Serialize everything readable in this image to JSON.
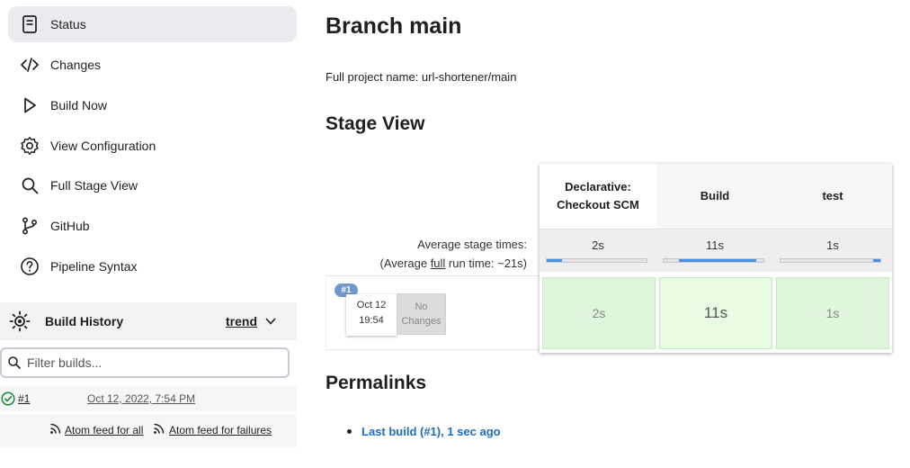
{
  "sidebar": {
    "items": [
      {
        "label": "Status",
        "icon": "document-icon",
        "active": true
      },
      {
        "label": "Changes",
        "icon": "code-icon"
      },
      {
        "label": "Build Now",
        "icon": "play-icon"
      },
      {
        "label": "View Configuration",
        "icon": "gear-icon"
      },
      {
        "label": "Full Stage View",
        "icon": "search-icon"
      },
      {
        "label": "GitHub",
        "icon": "branch-icon"
      },
      {
        "label": "Pipeline Syntax",
        "icon": "help-icon"
      }
    ]
  },
  "build_history": {
    "title": "Build History",
    "trend_label": "trend",
    "filter_placeholder": "Filter builds...",
    "builds": [
      {
        "number": "#1",
        "date": "Oct 12, 2022, 7:54 PM",
        "status": "success"
      }
    ],
    "feed_all": "Atom feed for all",
    "feed_failures": "Atom feed for failures"
  },
  "main": {
    "title": "Branch main",
    "full_name": "Full project name: url-shortener/main",
    "stage_view_title": "Stage View",
    "permalinks_title": "Permalinks",
    "permalinks": [
      "Last build (#1), 1 sec ago"
    ]
  },
  "stage_view": {
    "avg_label": "Average stage times:",
    "avg_full_prefix": "(Average ",
    "avg_full_link": "full",
    "avg_full_suffix": " run time: ~21s)",
    "stages": [
      {
        "name_line1": "Declarative:",
        "name_line2": "Checkout SCM",
        "avg": "2s",
        "bar_start": 0.0,
        "bar_fill": 0.15
      },
      {
        "name_line1": "Build",
        "name_line2": "",
        "avg": "11s",
        "bar_start": 0.15,
        "bar_fill": 0.78
      },
      {
        "name_line1": "test",
        "name_line2": "",
        "avg": "1s",
        "bar_start": 0.93,
        "bar_fill": 0.07
      }
    ],
    "run": {
      "badge": "#1",
      "date": "Oct 12",
      "time": "19:54",
      "changes_line1": "No",
      "changes_line2": "Changes",
      "durations": [
        "2s",
        "11s",
        "1s"
      ]
    }
  },
  "colors": {
    "accent": "#1b6ac9",
    "stage_success": "#dff5dc",
    "progress": "#4a90e2"
  }
}
